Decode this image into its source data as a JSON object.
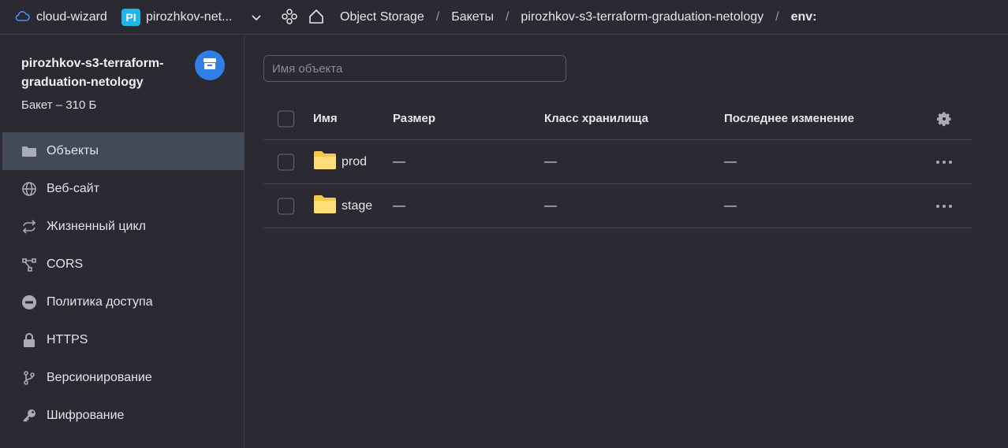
{
  "topbar": {
    "cloud_name": "cloud-wizard",
    "folder_badge": "PI",
    "folder_name": "pirozhkov-net...",
    "breadcrumbs": [
      "Object Storage",
      "Бакеты",
      "pirozhkov-s3-terraform-graduation-netology"
    ],
    "breadcrumb_current": "env:",
    "separator": "/"
  },
  "sidebar": {
    "bucket_name": "pirozhkov-s3-terraform-graduation-netology",
    "bucket_subtitle": "Бакет – 310 Б",
    "items": [
      {
        "label": "Объекты",
        "icon": "folder-icon"
      },
      {
        "label": "Веб-сайт",
        "icon": "globe-icon"
      },
      {
        "label": "Жизненный цикл",
        "icon": "cycle-icon"
      },
      {
        "label": "CORS",
        "icon": "cors-icon"
      },
      {
        "label": "Политика доступа",
        "icon": "no-entry-icon"
      },
      {
        "label": "HTTPS",
        "icon": "lock-icon"
      },
      {
        "label": "Версионирование",
        "icon": "branch-icon"
      },
      {
        "label": "Шифрование",
        "icon": "key-icon"
      }
    ]
  },
  "main": {
    "search_placeholder": "Имя объекта",
    "columns": {
      "name": "Имя",
      "size": "Размер",
      "storage_class": "Класс хранилища",
      "modified": "Последнее изменение"
    },
    "rows": [
      {
        "name": "prod",
        "size": "—",
        "storage_class": "—",
        "modified": "—"
      },
      {
        "name": "stage",
        "size": "—",
        "storage_class": "—",
        "modified": "—"
      }
    ]
  },
  "colors": {
    "background": "#2b2a33",
    "active_nav": "#434a57",
    "accent": "#2f7fe6",
    "badge": "#1fb6e8",
    "folder": "#ffd968"
  }
}
